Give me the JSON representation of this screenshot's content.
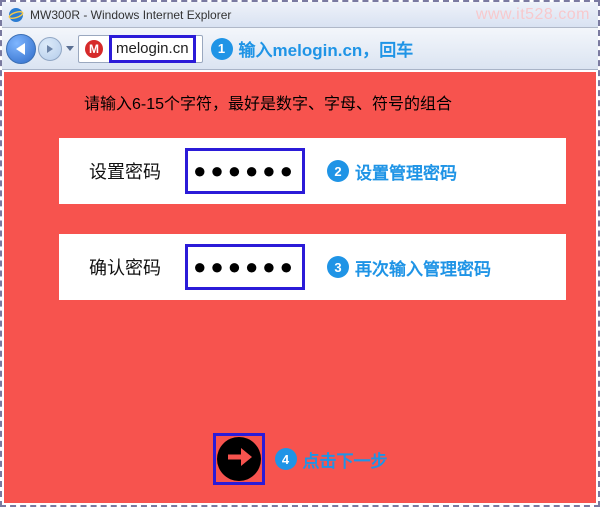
{
  "watermark": "www.it528.com",
  "window": {
    "title": "MW300R - Windows Internet Explorer"
  },
  "address_bar": {
    "favicon_letter": "M",
    "url": "melogin.cn"
  },
  "annotations": {
    "step1": {
      "num": "1",
      "text": "输入melogin.cn，回车"
    },
    "step2": {
      "num": "2",
      "text": "设置管理密码"
    },
    "step3": {
      "num": "3",
      "text": "再次输入管理密码"
    },
    "step4": {
      "num": "4",
      "text": "点击下一步"
    }
  },
  "page": {
    "instruction": "请输入6-15个字符，最好是数字、字母、符号的组合",
    "set_password_label": "设置密码",
    "set_password_value": "●●●●●●",
    "confirm_password_label": "确认密码",
    "confirm_password_value": "●●●●●●"
  }
}
